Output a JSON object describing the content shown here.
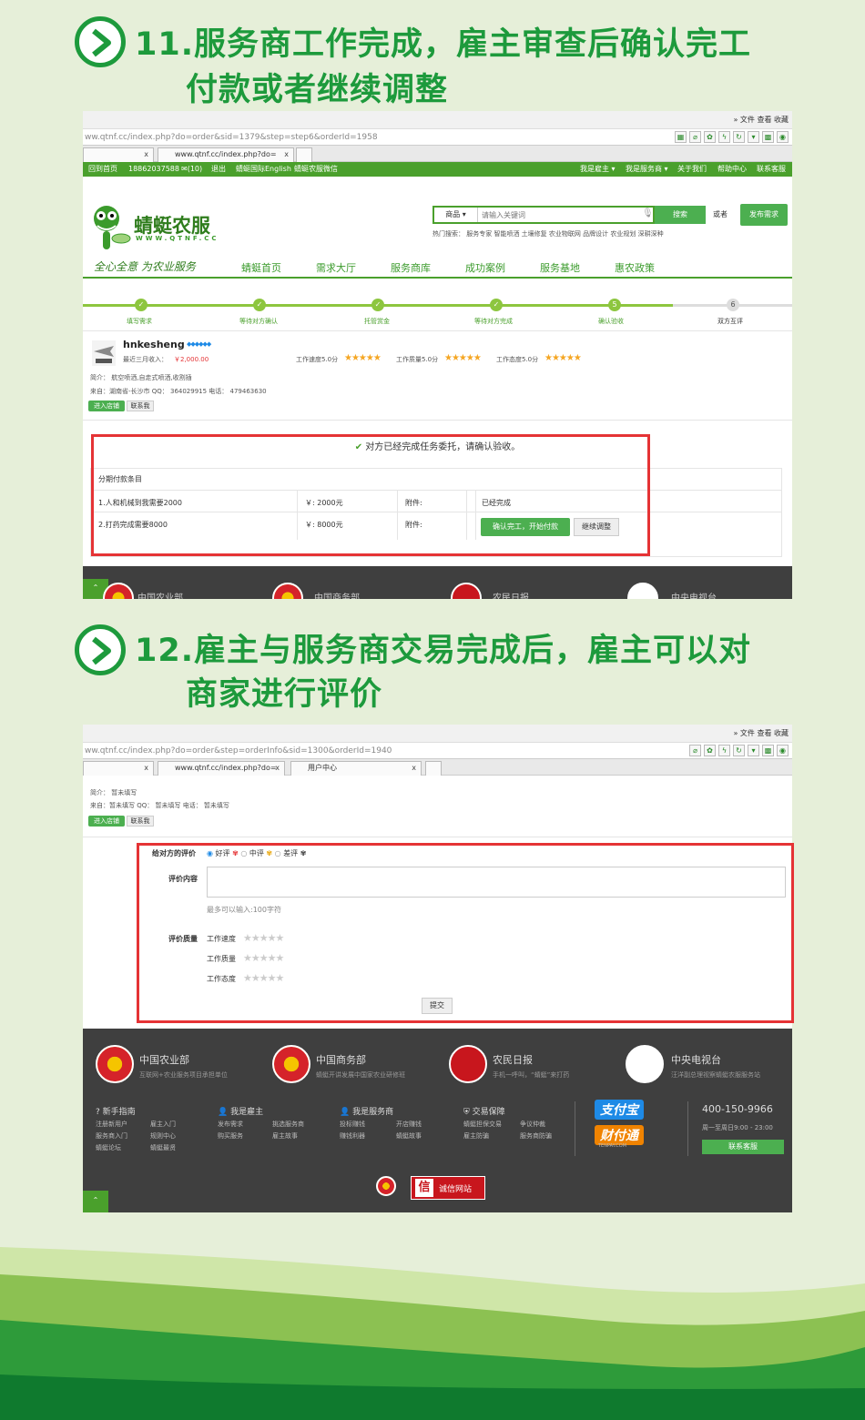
{
  "step11": {
    "line1": "11.服务商工作完成，雇主审查后确认完工",
    "line2": "付款或者继续调整"
  },
  "step12": {
    "line1": "12.雇主与服务商交易完成后，雇主可以对",
    "line2": "商家进行评价"
  },
  "browser1": {
    "menu": "»  文件  查看  收藏",
    "url": "ww.qtnf.cc/index.php?do=order&sid=1379&step=step6&orderId=1958",
    "tab1": "",
    "tab2": "www.qtnf.cc/index.php?do=",
    "close": "x"
  },
  "browser2": {
    "menu": "»  文件  查看  收藏",
    "url": "ww.qtnf.cc/index.php?do=order&step=orderInfo&sid=1300&orderId=1940",
    "tab2": "www.qtnf.cc/index.php?do=",
    "tab3": "用户中心",
    "close": "x"
  },
  "topnav": {
    "home": "回到首页",
    "phone": "18862037588",
    "mail": "✉(10)",
    "logout": "退出",
    "english": "蜻蜓国际English",
    "wechat": "蜻蜓农服微信",
    "employer": "我是雇主 ▾",
    "provider": "我是服务商 ▾",
    "about": "关于我们",
    "help": "帮助中心",
    "contact": "联系客服"
  },
  "site": {
    "logo_cn": "蜻蜓农服",
    "logo_en": "WWW.QTNF.CC",
    "category": "商品 ▾",
    "search_placeholder": "请输入关键词",
    "search_btn": "搜索",
    "or": "或者",
    "publish_btn": "发布需求",
    "hot": "热门搜索：  服务专家   智能喷洒   土壤修复   农业物联网   品牌设计   农业规划   深耕深种",
    "slogan": "全心全意 为农业服务",
    "nav": [
      "蜻蜓首页",
      "需求大厅",
      "服务商库",
      "成功案例",
      "服务基地",
      "惠农政策"
    ]
  },
  "progress": {
    "steps": [
      "填写需求",
      "等待对方确认",
      "托管赏金",
      "等待对方完成",
      "确认验收",
      "双方互评"
    ],
    "badges": [
      "✓",
      "✓",
      "✓",
      "✓",
      "5",
      "6"
    ]
  },
  "provider": {
    "name": "hnkesheng",
    "verified": "◆◆◆◆◆◆",
    "income_label": "最近三月收入：",
    "income": "￥2,000.00",
    "speed": "工作速度5.0分",
    "quality": "工作质量5.0分",
    "attitude": "工作态度5.0分",
    "stars": "★★★★★",
    "intro": "简介：  航空喷洒,自走式喷洒,收割插",
    "from": "来自：湖南省-长沙市    QQ：  364029915    电话：  479463630",
    "shop_btn": "进入店铺",
    "contact_btn": "联系我"
  },
  "acceptance": {
    "message": "对方已经完成任务委托，请确认验收。",
    "table_title": "分期付款条目",
    "rows": [
      {
        "item": "1.人和机械到我需要2000",
        "amount": "￥: 2000元",
        "attach": "附件:",
        "status": "已经完成"
      },
      {
        "item": "2.打药完成需要8000",
        "amount": "￥: 8000元",
        "attach": "附件:",
        "status": ""
      }
    ],
    "confirm_btn": "确认完工，开始付款",
    "adjust_btn": "继续调整"
  },
  "footer1": {
    "items": [
      "中国农业部",
      "中国商务部",
      "农民日报",
      "中央电视台"
    ]
  },
  "review": {
    "intro": "简介：  暂未填写",
    "from": "来自：暂未填写    QQ：  暂未填写    电话：  暂未填写",
    "shop_btn": "进入店铺",
    "contact_btn": "联系我",
    "rate_label": "给对方的评价",
    "good": "好评",
    "mid": "中评",
    "bad": "差评",
    "content_label": "评价内容",
    "hint": "最多可以输入:100字符",
    "quality_label": "评价质量",
    "speed": "工作速度",
    "quality": "工作质量",
    "attitude": "工作态度",
    "stars": "★★★★★",
    "submit": "提交"
  },
  "footer2": {
    "orgs": [
      {
        "name": "中国农业部",
        "sub": "互联网+农业服务项目承担单位"
      },
      {
        "name": "中国商务部",
        "sub": "蜻蜓开讲发展中国家农业研修班"
      },
      {
        "name": "农民日报",
        "sub": "手机一呼叫，“蜻蜓”来打药"
      },
      {
        "name": "中央电视台",
        "sub": "汪洋副总理视察蜻蜓农服服务站"
      }
    ],
    "cols": [
      {
        "title": "新手指南",
        "links": [
          "注册新用户",
          "雇主入门",
          "服务商入门",
          "规则中心",
          "蜻蜓论坛",
          "蜻蜓最贤"
        ]
      },
      {
        "title": "我是雇主",
        "links": [
          "发布需求",
          "挑选服务商",
          "购买服务",
          "雇主故事"
        ]
      },
      {
        "title": "我是服务商",
        "links": [
          "投标赚钱",
          "开店赚钱",
          "赚钱利器",
          "蜻蜓故事"
        ]
      },
      {
        "title": "交易保障",
        "links": [
          "蜻蜓担保交易",
          "争议仲裁",
          "雇主防骗",
          "服务商防骗"
        ]
      }
    ],
    "alipay": "支付宝",
    "tenpay": "财付通",
    "tenpay_en": "TENPAY.COM",
    "phone": "400-150-9966",
    "hours": "周一至周日9:00 - 23:00",
    "service_btn": "联系客服",
    "credit": "诚信网站",
    "credit_icon": "信"
  },
  "colors": {
    "brand_green": "#1d9a3c",
    "site_green": "#4aa02c",
    "alert_red": "#e53335",
    "footer_bg": "#3f3f3f"
  }
}
